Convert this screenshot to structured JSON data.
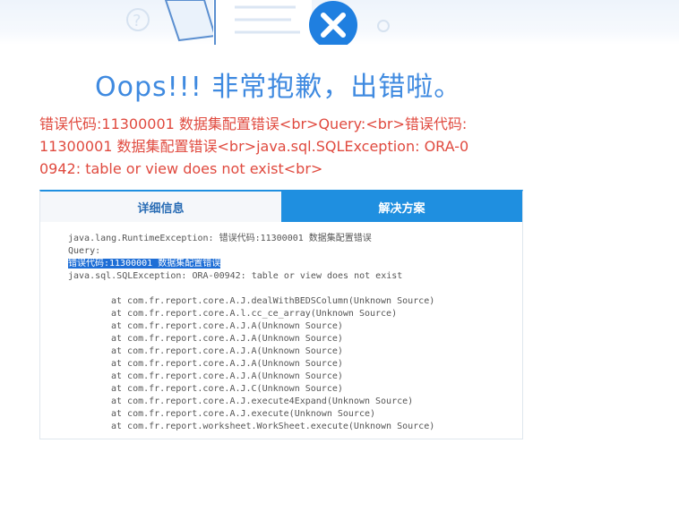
{
  "title": "Oops!!! 非常抱歉，出错啦。",
  "error_message": "错误代码:11300001 数据集配置错误<br>Query:<br>错误代码:11300001 数据集配置错误<br>java.sql.SQLException: ORA-00942: table or view does not exist<br>",
  "tabs": [
    {
      "label": "详细信息",
      "active": true
    },
    {
      "label": "解决方案",
      "active": false
    }
  ],
  "stack_trace": {
    "line1": "java.lang.RuntimeException: 错误代码:11300001 数据集配置错误",
    "line2": "Query:",
    "line3_highlighted": "错误代码:11300001 数据集配置错误",
    "line4": "java.sql.SQLException: ORA-00942: table or view does not exist",
    "frames": [
      "at com.fr.report.core.A.J.dealWithBEDSColumn(Unknown Source)",
      "at com.fr.report.core.A.l.cc_ce_array(Unknown Source)",
      "at com.fr.report.core.A.J.A(Unknown Source)",
      "at com.fr.report.core.A.J.A(Unknown Source)",
      "at com.fr.report.core.A.J.A(Unknown Source)",
      "at com.fr.report.core.A.J.A(Unknown Source)",
      "at com.fr.report.core.A.J.A(Unknown Source)",
      "at com.fr.report.core.A.J.C(Unknown Source)",
      "at com.fr.report.core.A.J.execute4Expand(Unknown Source)",
      "at com.fr.report.core.A.J.execute(Unknown Source)",
      "at com.fr.report.worksheet.WorkSheet.execute(Unknown Source)"
    ]
  },
  "colors": {
    "title": "#3f8ae0",
    "error_text": "#e04a3f",
    "tab_active_bg": "#f5f7fa",
    "tab_inactive_bg": "#1f8fe0",
    "highlight_bg": "#1e6ed6"
  }
}
